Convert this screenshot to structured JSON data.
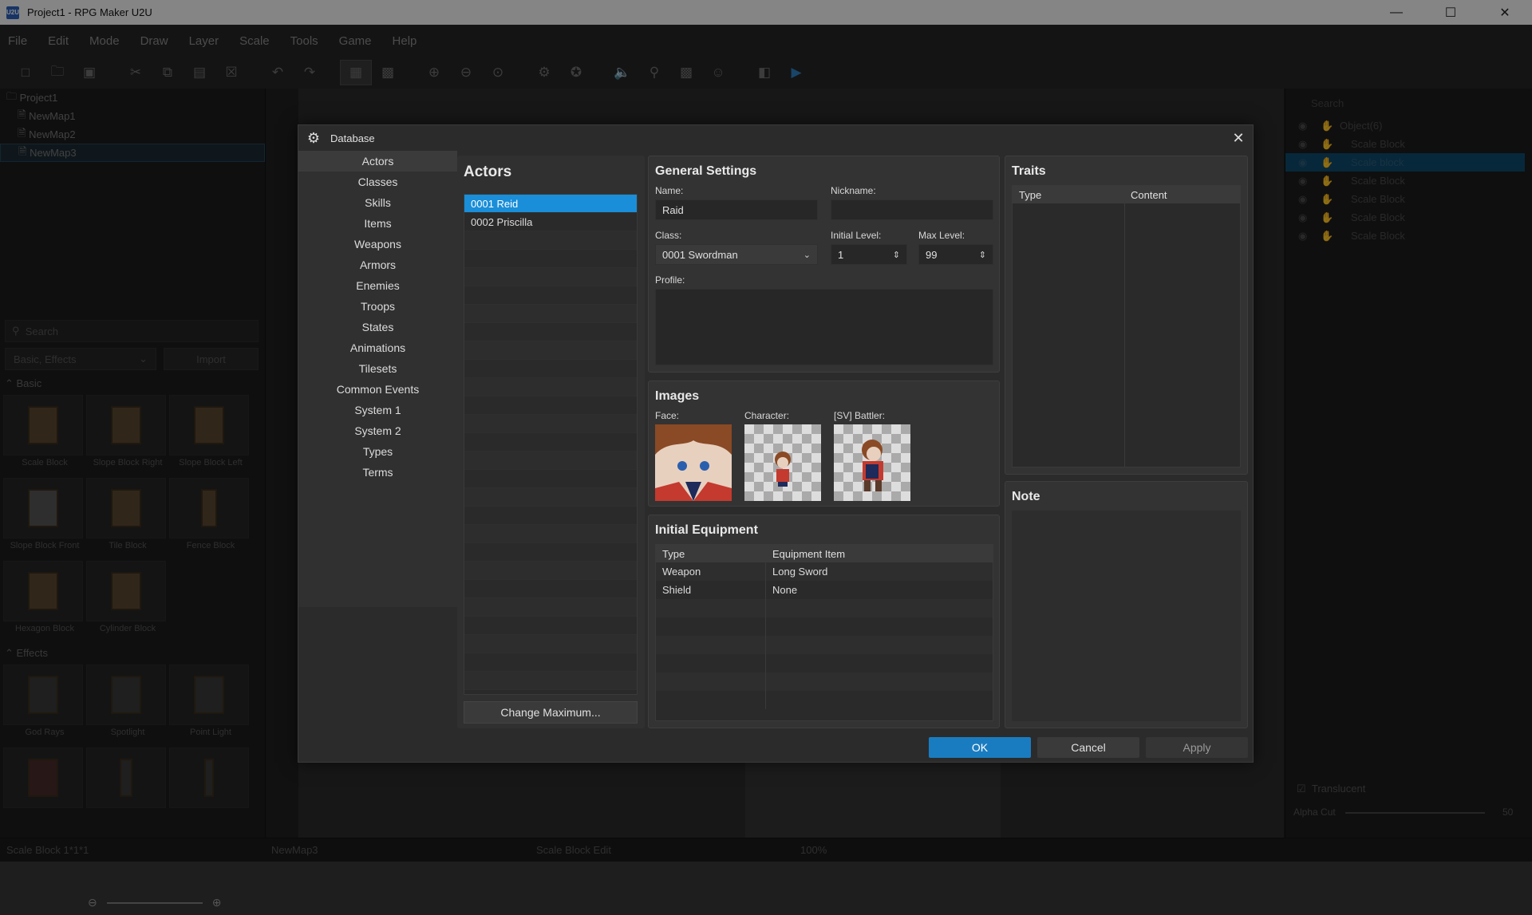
{
  "window": {
    "title": "Project1 - RPG Maker U2U",
    "app_icon": "U2U"
  },
  "menu": [
    "File",
    "Edit",
    "Mode",
    "Draw",
    "Layer",
    "Scale",
    "Tools",
    "Game",
    "Help"
  ],
  "project_tree": {
    "root": "Project1",
    "maps": [
      "NewMap1",
      "NewMap2",
      "NewMap3"
    ]
  },
  "library": {
    "search_placeholder": "Search",
    "filter": "Basic, Effects",
    "import_label": "Import",
    "basic_label": "Basic",
    "effects_label": "Effects",
    "basic_items": [
      "Scale Block",
      "Slope Block Right",
      "Slope Block Left",
      "Slope Block Front",
      "Tile Block",
      "Fence Block",
      "Hexagon Block",
      "Cylinder Block"
    ],
    "effect_items": [
      "God Rays",
      "Spotlight",
      "Point Light"
    ]
  },
  "objects": {
    "search_placeholder": "Search",
    "group": "Object(6)",
    "items": [
      "Scale Block",
      "Scale block",
      "Scale Block",
      "Scale Block",
      "Scale Block",
      "Scale Block"
    ],
    "translucent_label": "Translucent",
    "alpha_label": "Alpha Cut",
    "alpha_value": "50"
  },
  "status": {
    "item": "Scale Block 1*1*1",
    "map": "NewMap3",
    "mode": "Scale Block Edit",
    "zoom": "100%"
  },
  "dialog": {
    "title": "Database",
    "categories": [
      "Actors",
      "Classes",
      "Skills",
      "Items",
      "Weapons",
      "Armors",
      "Enemies",
      "Troops",
      "States",
      "Animations",
      "Tilesets",
      "Common Events",
      "System 1",
      "System 2",
      "Types",
      "Terms"
    ],
    "actors_title": "Actors",
    "actors": [
      "0001 Reid",
      "0002 Priscilla"
    ],
    "change_max": "Change Maximum...",
    "general": {
      "title": "General Settings",
      "name_label": "Name:",
      "name": "Raid",
      "nickname_label": "Nickname:",
      "nickname": "",
      "class_label": "Class:",
      "class": "0001 Swordman",
      "initial_level_label": "Initial Level:",
      "initial_level": "1",
      "max_level_label": "Max Level:",
      "max_level": "99",
      "profile_label": "Profile:"
    },
    "images": {
      "title": "Images",
      "face_label": "Face:",
      "character_label": "Character:",
      "battler_label": "[SV] Battler:"
    },
    "equipment": {
      "title": "Initial Equipment",
      "col_type": "Type",
      "col_item": "Equipment Item",
      "rows": [
        {
          "type": "Weapon",
          "item": "Long Sword"
        },
        {
          "type": "Shield",
          "item": "None"
        }
      ]
    },
    "traits": {
      "title": "Traits",
      "col_type": "Type",
      "col_content": "Content"
    },
    "note": {
      "title": "Note"
    },
    "buttons": {
      "ok": "OK",
      "cancel": "Cancel",
      "apply": "Apply"
    }
  }
}
